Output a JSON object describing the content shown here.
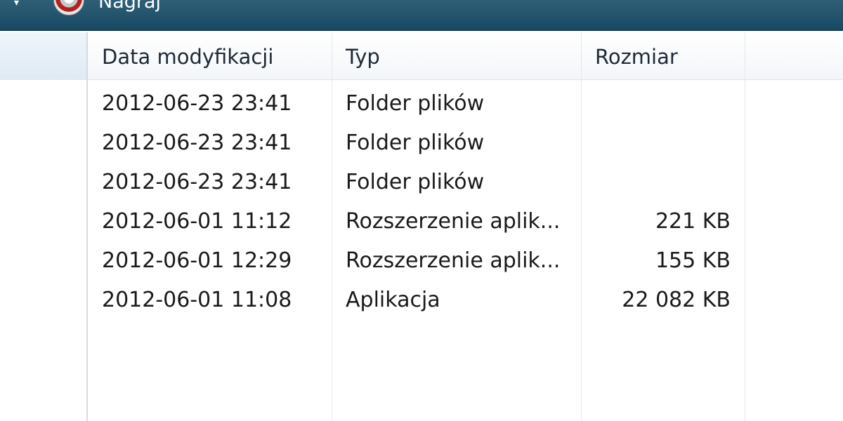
{
  "toolbar": {
    "burn_label": "Nagraj",
    "arrow_icon": "chevron-down-icon",
    "burn_icon": "burn-disc-icon"
  },
  "columns": {
    "date": "Data modyfikacji",
    "type": "Typ",
    "size": "Rozmiar"
  },
  "rows": [
    {
      "date": "2012-06-23 23:41",
      "type": "Folder plików",
      "size": ""
    },
    {
      "date": "2012-06-23 23:41",
      "type": "Folder plików",
      "size": ""
    },
    {
      "date": "2012-06-23 23:41",
      "type": "Folder plików",
      "size": ""
    },
    {
      "date": "2012-06-01 11:12",
      "type": "Rozszerzenie aplik...",
      "size": "221 KB"
    },
    {
      "date": "2012-06-01 12:29",
      "type": "Rozszerzenie aplik...",
      "size": "155 KB"
    },
    {
      "date": "2012-06-01 11:08",
      "type": "Aplikacja",
      "size": "22 082 KB"
    }
  ],
  "colors": {
    "toolbar": "#174a63",
    "header_text": "#1e2a36",
    "row_text": "#1a1a1a"
  }
}
